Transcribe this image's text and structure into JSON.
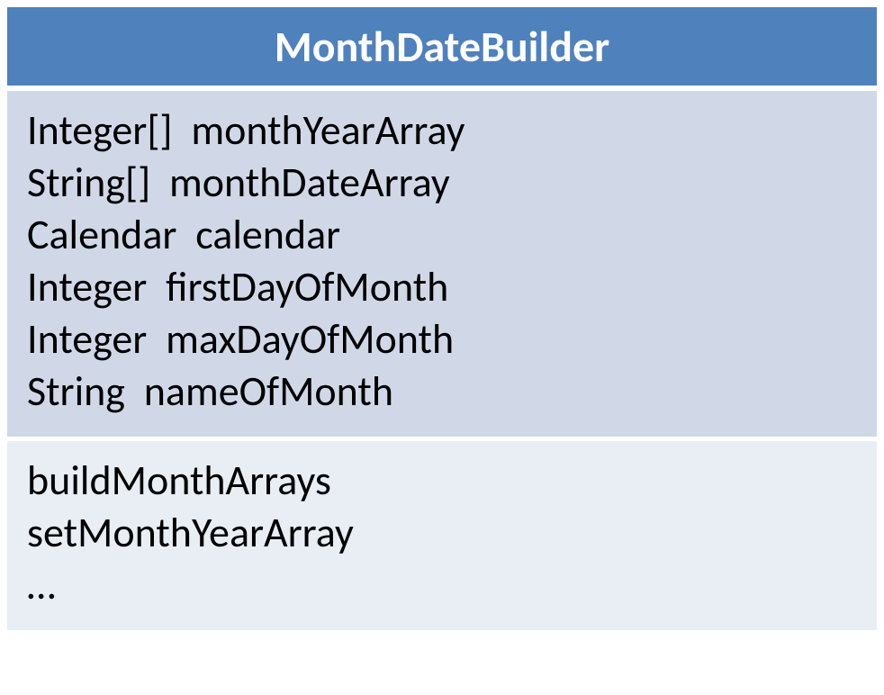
{
  "class": {
    "name": "MonthDateBuilder",
    "attributes": [
      "Integer[]  monthYearArray",
      "String[]  monthDateArray",
      "Calendar  calendar",
      "Integer  firstDayOfMonth",
      "Integer  maxDayOfMonth",
      "String  nameOfMonth"
    ],
    "operations": [
      "buildMonthArrays",
      "setMonthYearArray",
      "…"
    ]
  }
}
